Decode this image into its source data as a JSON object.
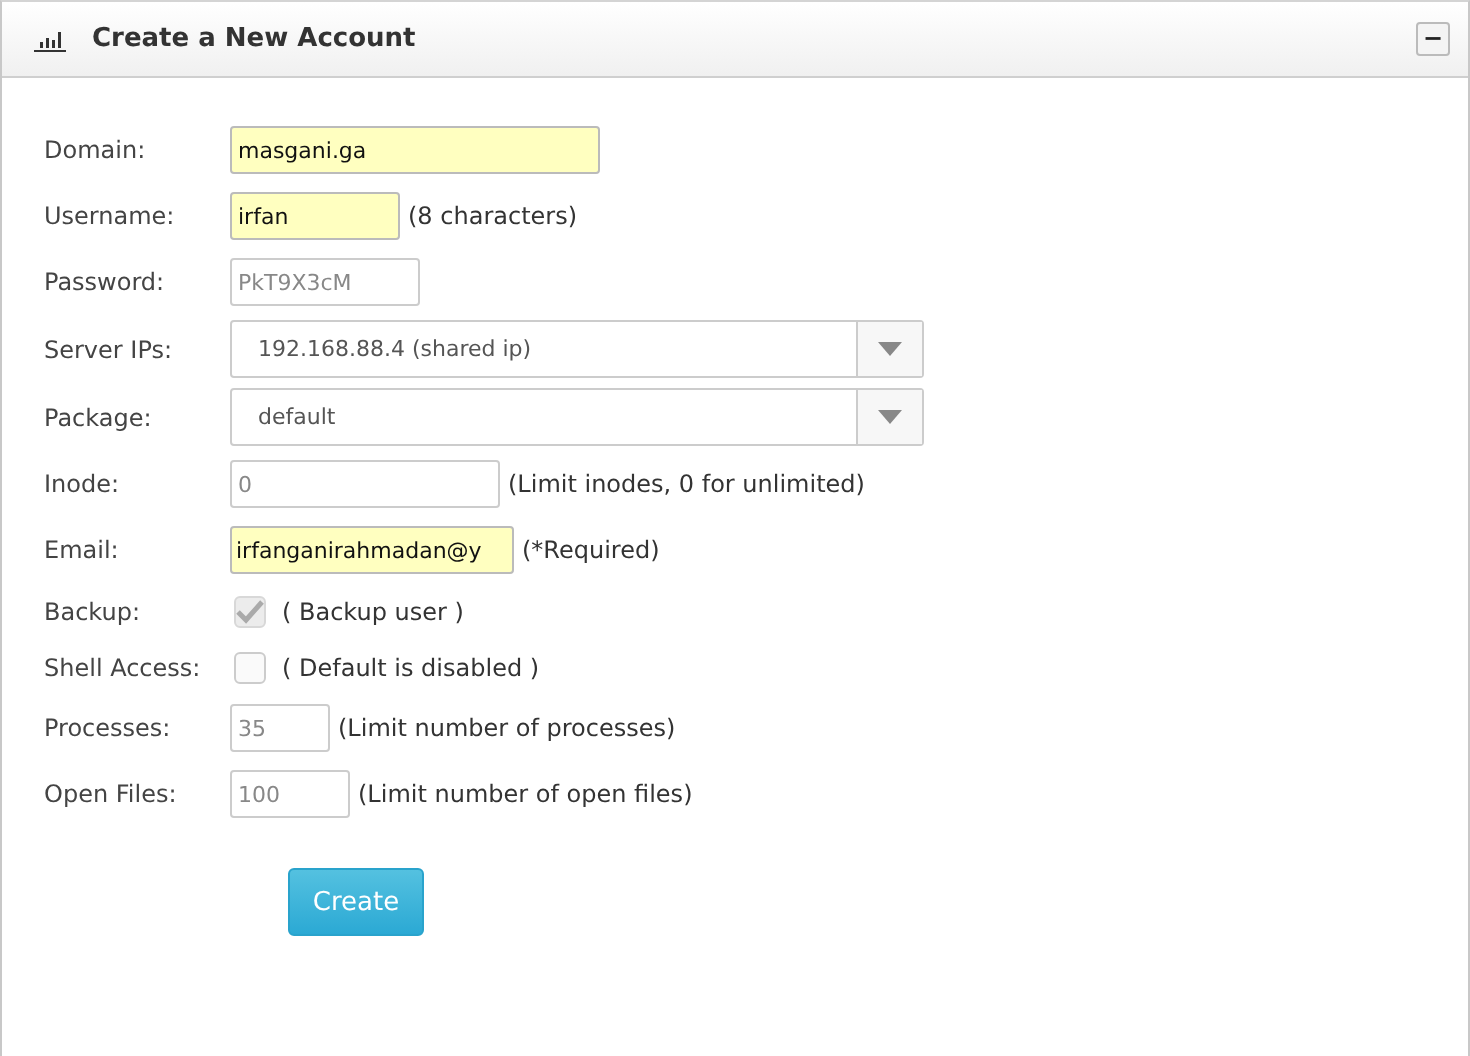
{
  "panel": {
    "title": "Create a New Account",
    "collapse_button": "−"
  },
  "fields": [
    {
      "kind": "text",
      "label": "Domain:",
      "value": "masgani.ga",
      "highlighted": true
    },
    {
      "kind": "text",
      "label": "Username:",
      "value": "irfan",
      "highlighted": true,
      "note": "(8 characters)"
    },
    {
      "kind": "text",
      "label": "Password:",
      "placeholder": "PkT9X3cM",
      "highlighted": false
    },
    {
      "kind": "select",
      "label": "Server IPs:",
      "value": "192.168.88.4 (shared ip)"
    },
    {
      "kind": "select",
      "label": "Package:",
      "value": "default"
    },
    {
      "kind": "text",
      "label": "Inode:",
      "placeholder": "0",
      "highlighted": false,
      "note": "(Limit inodes, 0 for unlimited)"
    },
    {
      "kind": "text",
      "label": "Email:",
      "value": "irfanganirahmadan@y",
      "highlighted": true,
      "note": "(*Required)"
    },
    {
      "kind": "checkbox",
      "label": "Backup:",
      "checked": true,
      "disabled": true,
      "note": "( Backup user )"
    },
    {
      "kind": "checkbox",
      "label": "Shell Access:",
      "checked": false,
      "disabled": false,
      "note": "( Default is disabled )"
    },
    {
      "kind": "text",
      "label": "Processes:",
      "placeholder": "35",
      "highlighted": false,
      "note": "(Limit number of processes)"
    },
    {
      "kind": "text",
      "label": "Open Files:",
      "placeholder": "100",
      "highlighted": false,
      "note": "(Limit number of open files)"
    }
  ],
  "submit": "Create"
}
